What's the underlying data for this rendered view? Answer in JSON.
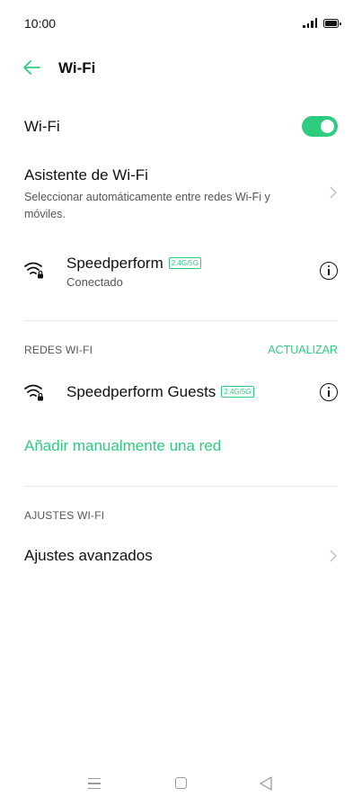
{
  "status_bar": {
    "time": "10:00"
  },
  "header": {
    "title": "Wi-Fi",
    "back_icon": "back-arrow-icon"
  },
  "wifi_toggle": {
    "label": "Wi-Fi",
    "enabled": true,
    "accent": "#2ecc7f"
  },
  "assistant": {
    "title": "Asistente de Wi-Fi",
    "description": "Seleccionar automáticamente entre redes Wi-Fi y móviles."
  },
  "connected_network": {
    "name": "Speedperform",
    "band_badge": "2.4G/5G",
    "status": "Conectado"
  },
  "networks_section": {
    "header": "REDES WI-FI",
    "refresh_label": "ACTUALIZAR",
    "networks": [
      {
        "name": "Speedperform Guests",
        "band_badge": "2.4G/5G"
      }
    ],
    "add_manual_label": "Añadir manualmente una red"
  },
  "settings_section": {
    "header": "AJUSTES WI-FI",
    "advanced_label": "Ajustes avanzados"
  },
  "nav_bar": {
    "icons": [
      "menu-icon",
      "home-icon",
      "back-icon"
    ]
  }
}
